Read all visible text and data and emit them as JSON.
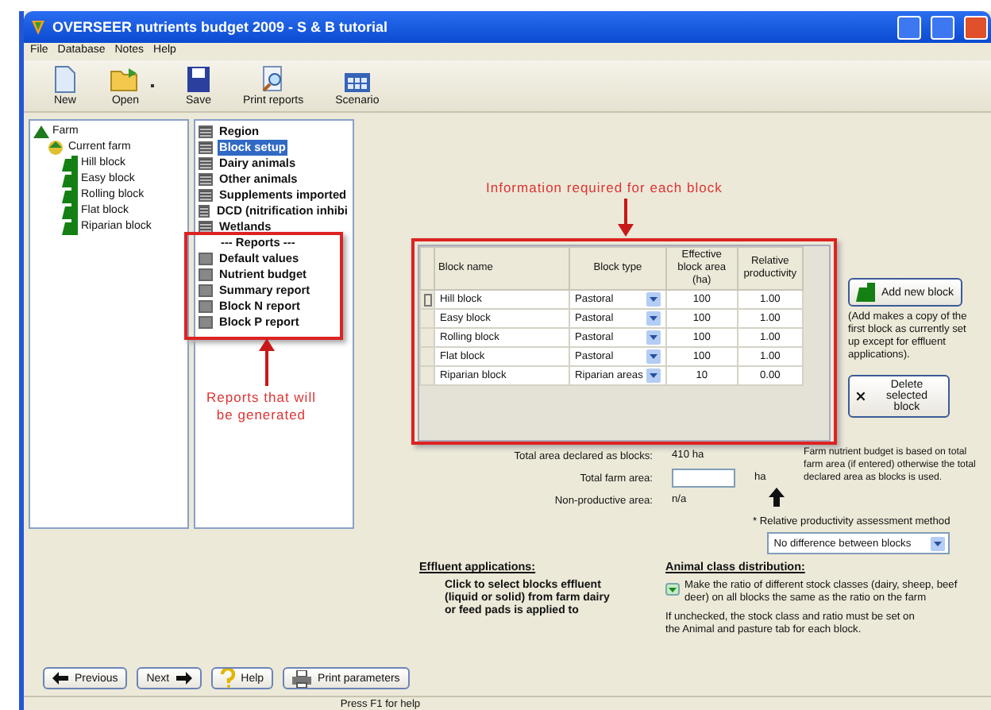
{
  "window": {
    "title": "OVERSEER nutrients budget 2009 - S & B tutorial"
  },
  "menu": [
    "File",
    "Database",
    "Notes",
    "Help"
  ],
  "toolbar": [
    {
      "label": "New",
      "kind": "new"
    },
    {
      "label": "Open",
      "kind": "open"
    },
    {
      "label": "Save",
      "kind": "save"
    },
    {
      "label": "Print reports",
      "kind": "print"
    },
    {
      "label": "Scenario",
      "kind": "scenario"
    }
  ],
  "tree": [
    {
      "label": "Farm",
      "kind": "farm",
      "children": [
        {
          "label": "Current farm",
          "kind": "current",
          "children": [
            {
              "label": "Hill block",
              "kind": "block"
            },
            {
              "label": "Easy block",
              "kind": "block"
            },
            {
              "label": "Rolling block",
              "kind": "block"
            },
            {
              "label": "Flat block",
              "kind": "block"
            },
            {
              "label": "Riparian block",
              "kind": "block"
            }
          ]
        }
      ]
    }
  ],
  "nav": [
    {
      "label": "Region",
      "kind": "page",
      "selected": false
    },
    {
      "label": "Block setup",
      "kind": "page",
      "selected": true
    },
    {
      "label": "Dairy animals",
      "kind": "page",
      "selected": false
    },
    {
      "label": "Other animals",
      "kind": "page",
      "selected": false
    },
    {
      "label": "Supplements imported",
      "kind": "page",
      "selected": false
    },
    {
      "label": "DCD (nitrification inhibi",
      "kind": "page",
      "selected": false
    },
    {
      "label": "Wetlands",
      "kind": "page",
      "selected": false
    },
    {
      "label": "--- Reports ---",
      "kind": "header"
    },
    {
      "label": "Default values",
      "kind": "report",
      "selected": false
    },
    {
      "label": "Nutrient budget",
      "kind": "report",
      "selected": false
    },
    {
      "label": "Summary report",
      "kind": "report",
      "selected": false
    },
    {
      "label": "Block N report",
      "kind": "report",
      "selected": false
    },
    {
      "label": "Block P report",
      "kind": "report",
      "selected": false
    }
  ],
  "annotations": {
    "table_note": "Information required for each block",
    "reports_note": "Reports that will be generated"
  },
  "table": {
    "columns": [
      "Block name",
      "Block type",
      "Effective block area (ha)",
      "Relative productivity"
    ],
    "rows": [
      {
        "name": "Hill block",
        "type": "Pastoral",
        "area": "100",
        "productivity": "1.00",
        "selected": true
      },
      {
        "name": "Easy block",
        "type": "Pastoral",
        "area": "100",
        "productivity": "1.00",
        "selected": false
      },
      {
        "name": "Rolling block",
        "type": "Pastoral",
        "area": "100",
        "productivity": "1.00",
        "selected": false
      },
      {
        "name": "Flat block",
        "type": "Pastoral",
        "area": "100",
        "productivity": "1.00",
        "selected": false
      },
      {
        "name": "Riparian block",
        "type": "Riparian areas",
        "area": "10",
        "productivity": "0.00",
        "selected": false
      }
    ]
  },
  "add_block": {
    "label": "Add new block",
    "note": "(Add makes a copy of the first block as currently set up except for effluent applications)."
  },
  "delete_block": {
    "label": "Delete selected block"
  },
  "totals": {
    "declared_label": "Total area declared as blocks:",
    "declared_value": "410 ha",
    "farm_label": "Total farm area:",
    "farm_unit": "ha",
    "nonproductive_label": "Non-productive area:",
    "nonproductive_value": "n/a"
  },
  "area_note": "Farm nutrient budget is based on total farm area (if entered) otherwise the total declared area as blocks is used.",
  "productivity_method": {
    "label": "* Relative productivity assessment method",
    "value": "No difference between blocks"
  },
  "effluent": {
    "title": "Effluent applications:",
    "text": "Click to select blocks effluent (liquid or solid) from farm dairy or feed pads is applied to"
  },
  "animal_class": {
    "title": "Animal class distribution:",
    "checkbox_label": "Make the ratio of different stock classes (dairy, sheep, beef deer) on all blocks the same as the ratio on the farm",
    "checked": true,
    "note": "If unchecked, the stock class and ratio must be set on the Animal and pasture tab for each block."
  },
  "buttons": [
    {
      "label": "Previous",
      "kind": "previous"
    },
    {
      "label": "Next",
      "kind": "next"
    },
    {
      "label": "Help",
      "kind": "help"
    },
    {
      "label": "Print parameters",
      "kind": "print"
    }
  ],
  "status_bar": "Press F1 for help"
}
